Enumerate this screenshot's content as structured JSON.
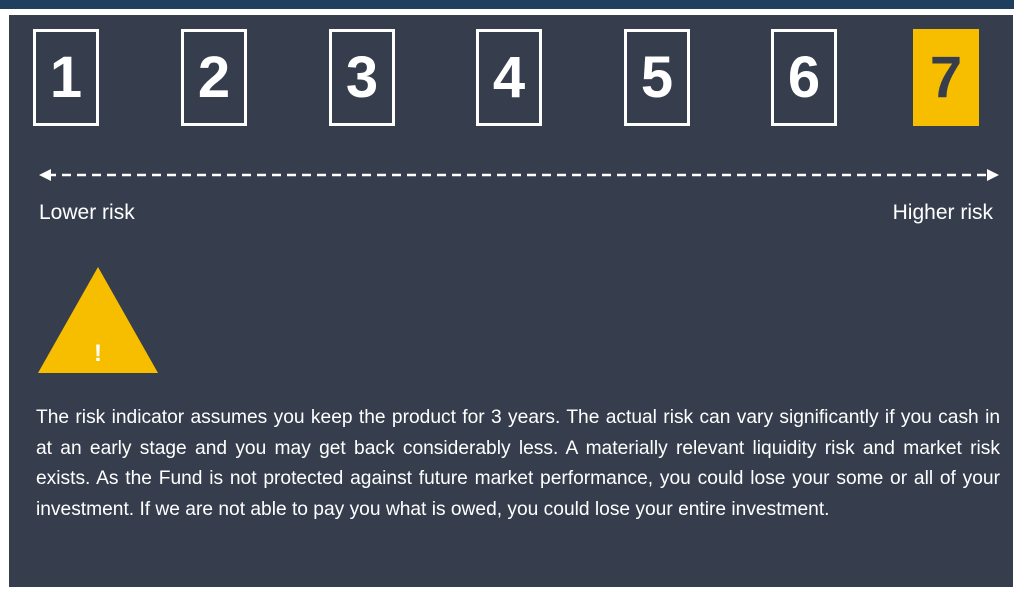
{
  "risk_scale": {
    "levels": [
      "1",
      "2",
      "3",
      "4",
      "5",
      "6",
      "7"
    ],
    "selected": "7",
    "selected_color": "#f7be00",
    "lower_label": "Lower risk",
    "higher_label": "Higher risk"
  },
  "warning": {
    "icon": "warning-triangle-icon",
    "glyph": "!"
  },
  "description": "The risk indicator assumes you keep the product for 3 years. The actual risk can vary significantly if you cash in at an early stage and you may get back considerably less. A materially relevant liquidity risk and market risk exists. As the Fund is not protected against future market performance, you could lose your some or all of your investment. If we are not able to pay you what is owed, you could lose your entire investment."
}
